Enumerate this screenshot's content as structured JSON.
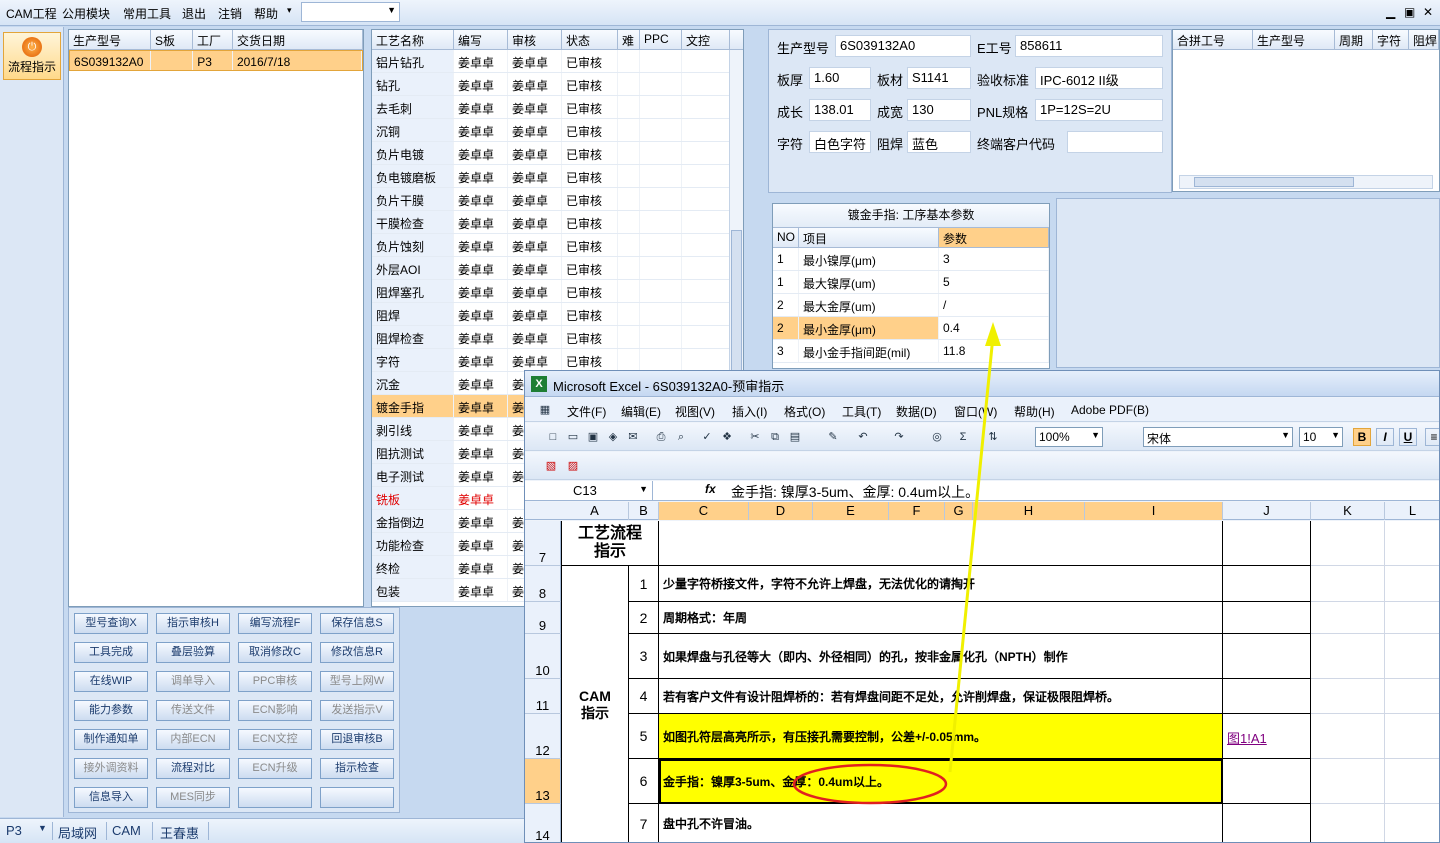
{
  "menubar": {
    "items": [
      "CAM工程",
      "公用模块",
      "常用工具",
      "退出",
      "注销",
      "帮助"
    ],
    "dropdown_value": "",
    "window_controls": [
      "▁",
      "▣",
      "✕"
    ]
  },
  "flow_button": {
    "label": "流程指示"
  },
  "orders": {
    "headers": [
      "生产型号",
      "S板",
      "工厂",
      "交货日期"
    ],
    "rows": [
      [
        "6S039132A0",
        "",
        "P3",
        "2016/7/18"
      ]
    ]
  },
  "process": {
    "headers": [
      "工艺名称",
      "编写",
      "审核",
      "状态",
      "难",
      "PPC",
      "文控"
    ],
    "rows": [
      [
        "铝片钻孔",
        "姜卓卓",
        "姜卓卓",
        "已审核"
      ],
      [
        "钻孔",
        "姜卓卓",
        "姜卓卓",
        "已审核"
      ],
      [
        "去毛刺",
        "姜卓卓",
        "姜卓卓",
        "已审核"
      ],
      [
        "沉铜",
        "姜卓卓",
        "姜卓卓",
        "已审核"
      ],
      [
        "负片电镀",
        "姜卓卓",
        "姜卓卓",
        "已审核"
      ],
      [
        "负电镀磨板",
        "姜卓卓",
        "姜卓卓",
        "已审核"
      ],
      [
        "负片干膜",
        "姜卓卓",
        "姜卓卓",
        "已审核"
      ],
      [
        "干膜检查",
        "姜卓卓",
        "姜卓卓",
        "已审核"
      ],
      [
        "负片蚀刻",
        "姜卓卓",
        "姜卓卓",
        "已审核"
      ],
      [
        "外层AOI",
        "姜卓卓",
        "姜卓卓",
        "已审核"
      ],
      [
        "阻焊塞孔",
        "姜卓卓",
        "姜卓卓",
        "已审核"
      ],
      [
        "阻焊",
        "姜卓卓",
        "姜卓卓",
        "已审核"
      ],
      [
        "阻焊检查",
        "姜卓卓",
        "姜卓卓",
        "已审核"
      ],
      [
        "字符",
        "姜卓卓",
        "姜卓卓",
        "已审核"
      ],
      [
        "沉金",
        "姜卓卓",
        "姜卓卓",
        "已审核"
      ],
      [
        "镀金手指",
        "姜卓卓",
        "姜",
        ""
      ],
      [
        "剥引线",
        "姜卓卓",
        "姜",
        ""
      ],
      [
        "阻抗测试",
        "姜卓卓",
        "姜",
        ""
      ],
      [
        "电子测试",
        "姜卓卓",
        "姜",
        ""
      ],
      [
        "铣板",
        "姜卓卓",
        "",
        ""
      ],
      [
        "金指倒边",
        "姜卓卓",
        "姜",
        ""
      ],
      [
        "功能检查",
        "姜卓卓",
        "姜",
        ""
      ],
      [
        "终检",
        "姜卓卓",
        "姜",
        ""
      ],
      [
        "包装",
        "姜卓卓",
        "姜",
        ""
      ]
    ]
  },
  "buttons": [
    {
      "label": "型号查询X",
      "enabled": true
    },
    {
      "label": "指示审核H",
      "enabled": true
    },
    {
      "label": "编写流程F",
      "enabled": true
    },
    {
      "label": "保存信息S",
      "enabled": true
    },
    {
      "label": "工具完成",
      "enabled": true
    },
    {
      "label": "叠层验算",
      "enabled": true
    },
    {
      "label": "取消修改C",
      "enabled": true
    },
    {
      "label": "修改信息R",
      "enabled": true
    },
    {
      "label": "在线WIP",
      "enabled": true
    },
    {
      "label": "调单导入",
      "enabled": false
    },
    {
      "label": "PPC审核",
      "enabled": false
    },
    {
      "label": "型号上网W",
      "enabled": false
    },
    {
      "label": "能力参数",
      "enabled": true
    },
    {
      "label": "传送文件",
      "enabled": false
    },
    {
      "label": "ECN影响",
      "enabled": false
    },
    {
      "label": "发送指示V",
      "enabled": false
    },
    {
      "label": "制作通知单",
      "enabled": true
    },
    {
      "label": "内部ECN",
      "enabled": false
    },
    {
      "label": "ECN文控",
      "enabled": false
    },
    {
      "label": "回退审核B",
      "enabled": true
    },
    {
      "label": "接外调资料",
      "enabled": false
    },
    {
      "label": "流程对比",
      "enabled": true
    },
    {
      "label": "ECN升级",
      "enabled": false
    },
    {
      "label": "指示检查",
      "enabled": true
    },
    {
      "label": "信息导入",
      "enabled": true
    },
    {
      "label": "MES同步",
      "enabled": false
    },
    {
      "label": "",
      "enabled": true
    },
    {
      "label": "",
      "enabled": true
    }
  ],
  "info": {
    "model_label": "生产型号",
    "model": "6S039132A0",
    "eno_label": "E工号",
    "eno": "858611",
    "thick_label": "板厚",
    "thick": "1.60",
    "material_label": "板材",
    "material": "S1141",
    "std_label": "验收标准",
    "std": "IPC-6012 II级",
    "len_label": "成长",
    "len": "138.01",
    "width_label": "成宽",
    "width": "130",
    "pnl_label": "PNL规格",
    "pnl": "1P=12S=2U",
    "char_label": "字符",
    "char": "白色字符",
    "mask_label": "阻焊",
    "mask": "蓝色",
    "cust_label": "终端客户代码",
    "cust": ""
  },
  "merge": {
    "headers": [
      "合拼工号",
      "生产型号",
      "周期",
      "字符",
      "阻焊"
    ]
  },
  "params": {
    "title": "镀金手指: 工序基本参数",
    "headers": [
      "NO",
      "项目",
      "参数"
    ],
    "rows": [
      [
        "1",
        "最小镍厚(μm)",
        "3"
      ],
      [
        "1",
        "最大镍厚(um)",
        "5"
      ],
      [
        "2",
        "最大金厚(um)",
        "/"
      ],
      [
        "2",
        "最小金厚(μm)",
        "0.4"
      ],
      [
        "3",
        "最小金手指间距(mil)",
        "11.8"
      ]
    ]
  },
  "status": {
    "items": [
      "P3",
      "局域网",
      "CAM",
      "王春惠"
    ]
  },
  "excel": {
    "title": "Microsoft Excel - 6S039132A0-预审指示",
    "menu": [
      "文件(F)",
      "编辑(E)",
      "视图(V)",
      "插入(I)",
      "格式(O)",
      "工具(T)",
      "数据(D)",
      "窗口(W)",
      "帮助(H)",
      "Adobe PDF(B)"
    ],
    "zoom": "100%",
    "font": "宋体",
    "font_size": "10",
    "name_box": "C13",
    "formula": "金手指: 镍厚3-5um、金厚: 0.4um以上。",
    "columns": [
      "A",
      "B",
      "C",
      "D",
      "E",
      "F",
      "G",
      "H",
      "I",
      "J",
      "K",
      "L"
    ],
    "row_headers": [
      "7",
      "8",
      "9",
      "10",
      "11",
      "12",
      "13",
      "14"
    ],
    "header_cell": "工艺流程\n指示",
    "section": "CAM\n指示",
    "lines": [
      {
        "no": "1",
        "text": "少量字符桥接文件，字符不允许上焊盘，无法优化的请掏开",
        "yellow": false
      },
      {
        "no": "2",
        "text": "周期格式：年周",
        "yellow": false
      },
      {
        "no": "3",
        "text": "如果焊盘与孔径等大（即内、外径相同）的孔，按非金属化孔（NPTH）制作",
        "yellow": false
      },
      {
        "no": "4",
        "text": "若有客户文件有设计阻焊桥的：若有焊盘间距不足处，允许削焊盘，保证极限阻焊桥。",
        "yellow": false
      },
      {
        "no": "5",
        "text": "如图孔符层高亮所示，有压接孔需要控制，公差+/-0.05mm。",
        "yellow": true
      },
      {
        "no": "6",
        "text": "金手指：镍厚3-5um、金厚：0.4um以上。",
        "yellow": true
      },
      {
        "no": "7",
        "text": "盘中孔不许冒油。",
        "yellow": false
      }
    ],
    "link": "图1!A1"
  }
}
